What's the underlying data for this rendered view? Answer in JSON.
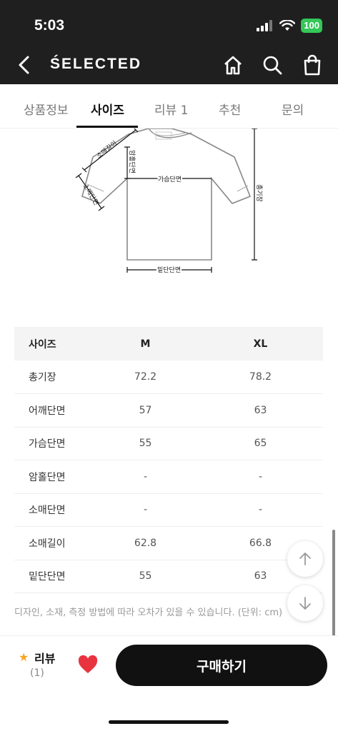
{
  "status_bar": {
    "time": "5:03",
    "battery": "100"
  },
  "header": {
    "brand": "ŚELECTED"
  },
  "tabs": [
    {
      "label": "상품정보"
    },
    {
      "label": "사이즈"
    },
    {
      "label": "리뷰 1"
    },
    {
      "label": "추천"
    },
    {
      "label": "문의"
    }
  ],
  "diagram_labels": {
    "sleeve_length": "소매길이",
    "sleeve_width": "소매단면",
    "armhole": "암홀단면",
    "chest": "가슴단면",
    "total_length": "총기장",
    "hem": "밑단단면"
  },
  "table": {
    "headers": [
      "사이즈",
      "M",
      "XL"
    ],
    "rows": [
      [
        "총기장",
        "72.2",
        "78.2"
      ],
      [
        "어깨단면",
        "57",
        "63"
      ],
      [
        "가슴단면",
        "55",
        "65"
      ],
      [
        "암홀단면",
        "-",
        "-"
      ],
      [
        "소매단면",
        "-",
        "-"
      ],
      [
        "소매길이",
        "62.8",
        "66.8"
      ],
      [
        "밑단단면",
        "55",
        "63"
      ]
    ]
  },
  "note": "디자인, 소재, 측정 방법에 따라 오차가 있을 수 있습니다. (단위: cm)",
  "bottom_bar": {
    "review_label": "리뷰",
    "review_count": "(1)",
    "buy_label": "구매하기"
  }
}
